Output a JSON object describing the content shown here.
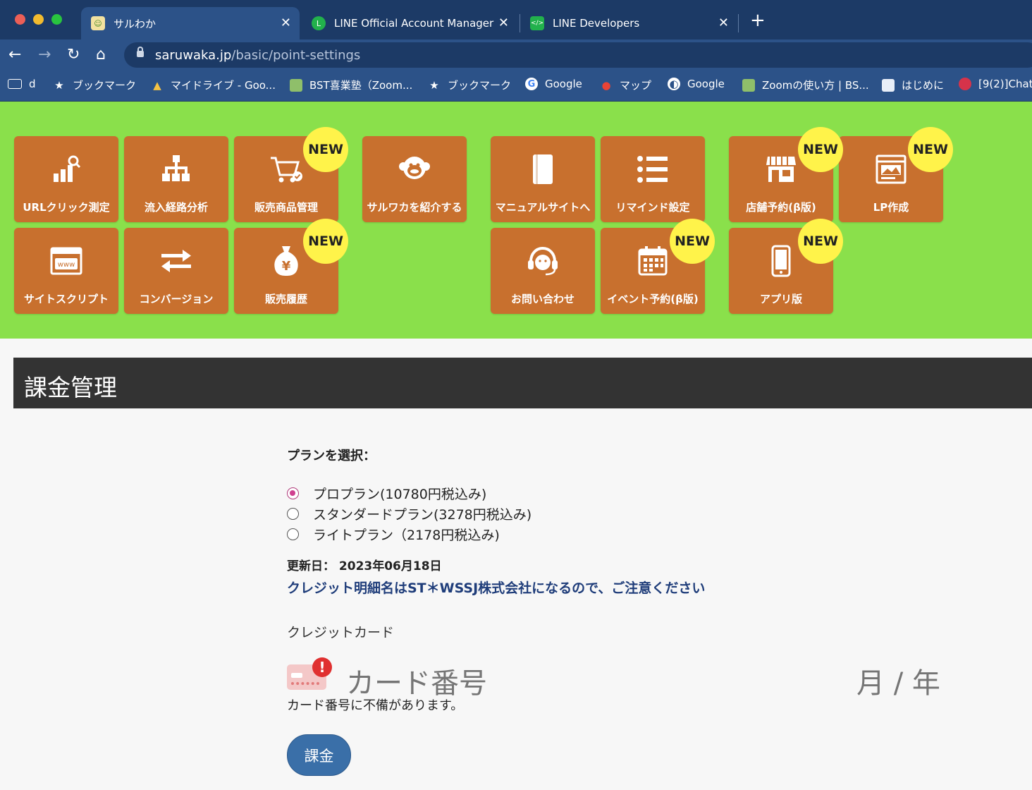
{
  "browser": {
    "tabs": [
      {
        "title": "サルわか",
        "active": true
      },
      {
        "title": "LINE Official Account Manager",
        "active": false
      },
      {
        "title": "LINE Developers",
        "active": false
      }
    ],
    "url_host": "saruwaka.jp",
    "url_path": "/basic/point-settings",
    "bookmarks": [
      {
        "label": "d",
        "icon": "folder-icon"
      },
      {
        "label": "ブックマーク",
        "icon": "star-icon"
      },
      {
        "label": "マイドライブ - Goo...",
        "icon": "google-drive-icon"
      },
      {
        "label": "BST喜業塾（Zoom...",
        "icon": "site-icon"
      },
      {
        "label": "ブックマーク",
        "icon": "star-icon"
      },
      {
        "label": "Google",
        "icon": "google-icon"
      },
      {
        "label": "マップ",
        "icon": "maps-icon"
      },
      {
        "label": "Google",
        "icon": "globe-icon"
      },
      {
        "label": "Zoomの使い方 | BS...",
        "icon": "site-icon"
      },
      {
        "label": "はじめに",
        "icon": "site-icon"
      },
      {
        "label": "[9(2)]Chat",
        "icon": "site-icon"
      }
    ]
  },
  "menu": {
    "badge": "NEW",
    "tiles": [
      {
        "label": "URLクリック測定",
        "icon": "chart-search-icon"
      },
      {
        "label": "流入経路分析",
        "icon": "sitemap-icon"
      },
      {
        "label": "販売商品管理",
        "icon": "cart-icon"
      },
      {
        "label": "サルワカを紹介する",
        "icon": "monkey-icon"
      },
      {
        "label": "マニュアルサイトへ",
        "icon": "book-icon"
      },
      {
        "label": "リマインド設定",
        "icon": "list-icon"
      },
      {
        "label": "店舗予約(β版)",
        "icon": "store-icon"
      },
      {
        "label": "LP作成",
        "icon": "landing-page-icon"
      },
      {
        "label": "サイトスクリプト",
        "icon": "www-window-icon"
      },
      {
        "label": "コンバージョン",
        "icon": "exchange-arrows-icon"
      },
      {
        "label": "販売履歴",
        "icon": "money-bag-icon"
      },
      {
        "label": "お問い合わせ",
        "icon": "headset-icon"
      },
      {
        "label": "イベント予約(β版)",
        "icon": "calendar-icon"
      },
      {
        "label": "アプリ版",
        "icon": "smartphone-icon"
      }
    ]
  },
  "page": {
    "title": "課金管理",
    "plan_label": "プランを選択：",
    "plans": [
      {
        "label": "プロプラン(10780円税込み)",
        "checked": true
      },
      {
        "label": "スタンダードプラン(3278円税込み)",
        "checked": false
      },
      {
        "label": "ライトプラン（2178円税込み)",
        "checked": false
      }
    ],
    "update_date": "更新日： 2023年06月18日",
    "notice": "クレジット明細名はST＊WSSJ株式会社になるので、ご注意ください",
    "cc_label": "クレジットカード",
    "card_number_placeholder": "カード番号",
    "expiry_placeholder": "月 / 年",
    "card_error": "カード番号に不備があります。",
    "pay_button": "課金"
  },
  "colors": {
    "tabbar": "#1c3a66",
    "toolbar": "#2c5288",
    "menu_bg": "#8ae04b",
    "tile": "#c8702e",
    "badge": "#fff34a",
    "header": "#333333",
    "notice": "#1f3d7a",
    "button": "#3a6fa8"
  }
}
